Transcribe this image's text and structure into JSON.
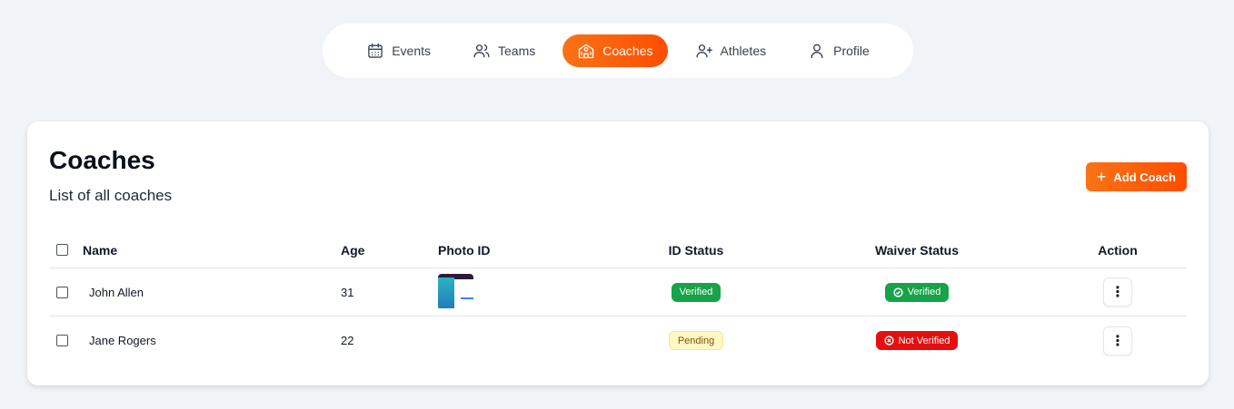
{
  "nav": {
    "items": [
      {
        "label": "Events",
        "icon": "calendar-icon",
        "active": false
      },
      {
        "label": "Teams",
        "icon": "users-icon",
        "active": false
      },
      {
        "label": "Coaches",
        "icon": "school-icon",
        "active": true
      },
      {
        "label": "Athletes",
        "icon": "user-plus-icon",
        "active": false
      },
      {
        "label": "Profile",
        "icon": "user-icon",
        "active": false
      }
    ]
  },
  "page": {
    "title": "Coaches",
    "subtitle": "List of all coaches",
    "add_button": "Add Coach"
  },
  "table": {
    "columns": [
      "Name",
      "Age",
      "Photo ID",
      "ID Status",
      "Waiver Status",
      "Action"
    ],
    "rows": [
      {
        "name": "John Allen",
        "age": "31",
        "has_photo": true,
        "id_status": "Verified",
        "waiver_status": "Verified"
      },
      {
        "name": "Jane Rogers",
        "age": "22",
        "has_photo": false,
        "id_status": "Pending",
        "waiver_status": "Not Verified"
      }
    ]
  },
  "colors": {
    "accent_start": "#f97316",
    "accent_end": "#ff4d00",
    "verified": "#16a34a",
    "not_verified": "#e60f0f",
    "pending_bg": "#fef9c3"
  }
}
